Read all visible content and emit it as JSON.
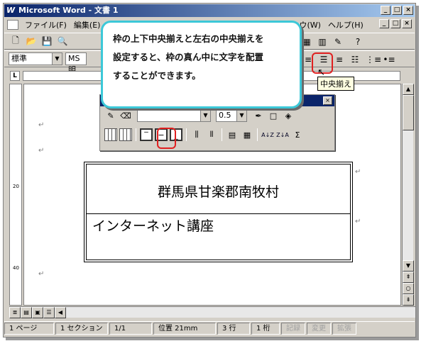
{
  "window": {
    "title": "Microsoft Word - 文書 1",
    "app_icon": "W",
    "controls": [
      "_",
      "□",
      "×"
    ]
  },
  "menu": {
    "items": [
      "ファイル(F)",
      "編集(E)",
      "ウ(W)",
      "ヘルプ(H)"
    ],
    "doc_controls": [
      "_",
      "□",
      "×"
    ]
  },
  "toolbar2": {
    "style_value": "標準",
    "font_value": "MS 明"
  },
  "callout": {
    "lines": [
      "枠の上下中央揃えと左右の中央揃えを",
      "設定すると、枠の真ん中に文字を配置",
      "することができます。"
    ]
  },
  "tooltip": {
    "text": "中央揃え"
  },
  "floating_toolbar": {
    "size_value": "0.5",
    "sort_asc": "A↓Z",
    "sort_desc": "Z↓A",
    "sum": "Σ"
  },
  "document": {
    "cell1": "群馬県甘楽郡南牧村",
    "cell2": "インターネット講座",
    "mark": "↵"
  },
  "vruler": {
    "labels": [
      "20",
      "40"
    ]
  },
  "statusbar": {
    "page": "1 ページ",
    "section": "1 セクション",
    "pages": "1/1",
    "position": "位置 21mm",
    "line": "3 行",
    "column": "1 桁",
    "rec": "記録",
    "trk": "変更",
    "ext": "拡張"
  },
  "colors": {
    "titlebar": "#0a246a",
    "callout_border": "#3cc8d8",
    "highlight": "#e02020",
    "chrome": "#d4d0c8"
  }
}
